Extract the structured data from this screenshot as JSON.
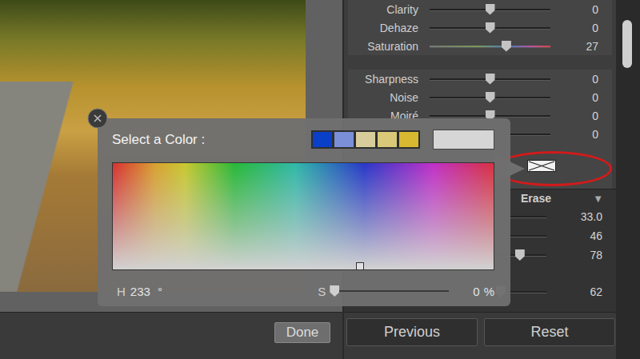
{
  "adjust_sliders": [
    {
      "label": "Clarity",
      "value": "0",
      "level": 0.5,
      "kind": "plain"
    },
    {
      "label": "Dehaze",
      "value": "0",
      "level": 0.5,
      "kind": "plain"
    },
    {
      "label": "Saturation",
      "value": "27",
      "level": 0.635,
      "kind": "saturation"
    }
  ],
  "detail_sliders": [
    {
      "label": "Sharpness",
      "value": "0",
      "level": 0.5
    },
    {
      "label": "Noise",
      "value": "0",
      "level": 0.5
    },
    {
      "label": "Moiré",
      "value": "0",
      "level": 0.5
    },
    {
      "label": "",
      "value": "0",
      "level": 0.5
    }
  ],
  "color_swatch": {
    "empty": true,
    "highlighted": true
  },
  "brush": {
    "mode": "Erase",
    "menu_icon": "▼",
    "sliders": [
      {
        "value": "33.0",
        "level": 0.33
      },
      {
        "value": "46",
        "level": 0.46
      },
      {
        "value": "78",
        "level": 0.78
      },
      {
        "value": "62",
        "level": 0.62
      }
    ]
  },
  "buttons": {
    "done": "Done",
    "previous": "Previous",
    "reset": "Reset"
  },
  "color_picker": {
    "title": "Select a Color :",
    "recent": [
      {
        "color": "#0a40c8"
      },
      {
        "color": "#7b8fd8"
      },
      {
        "color": "#d8cc9c"
      },
      {
        "color": "#d8c878"
      },
      {
        "color": "#d8b830"
      }
    ],
    "current": {
      "color": "#d6d6d6"
    },
    "hue": {
      "label": "H",
      "value": "233",
      "unit": "°"
    },
    "saturation": {
      "label": "S",
      "value": "0",
      "unit": "%",
      "level": 0
    }
  }
}
